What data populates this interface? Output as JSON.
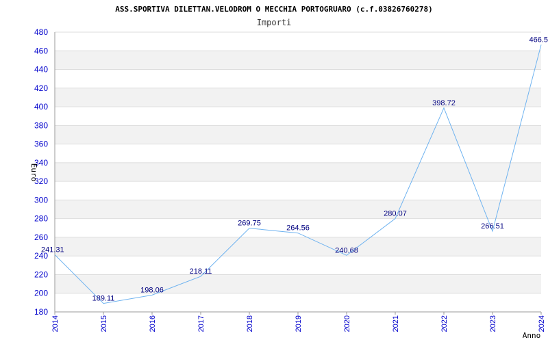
{
  "chart_data": {
    "type": "line",
    "title": "ASS.SPORTIVA DILETTAN.VELODROM O MECCHIA PORTOGRUARO (c.f.03826760278)",
    "subtitle": "Importi",
    "xlabel": "Anno",
    "ylabel": "Euro",
    "categories": [
      "2014",
      "2015",
      "2016",
      "2017",
      "2018",
      "2019",
      "2020",
      "2021",
      "2022",
      "2023",
      "2024"
    ],
    "series": [
      {
        "values": [
          241.31,
          189.11,
          198.06,
          218.11,
          269.75,
          264.56,
          240.68,
          280.07,
          398.72,
          266.51,
          466.5
        ],
        "labels": [
          "241.31",
          "189.11",
          "198.06",
          "218.11",
          "269.75",
          "264.56",
          "240.68",
          "280.07",
          "398.72",
          "266.51",
          "466.5"
        ]
      }
    ],
    "ylim": [
      180,
      480
    ],
    "yticks": [
      180,
      200,
      220,
      240,
      260,
      280,
      300,
      320,
      340,
      360,
      380,
      400,
      420,
      440,
      460,
      480
    ],
    "grid": true,
    "line_color": "#6fb3f0",
    "band_color": "#f2f2f2",
    "tick_color": "#0000cc",
    "label_color": "#000080"
  }
}
